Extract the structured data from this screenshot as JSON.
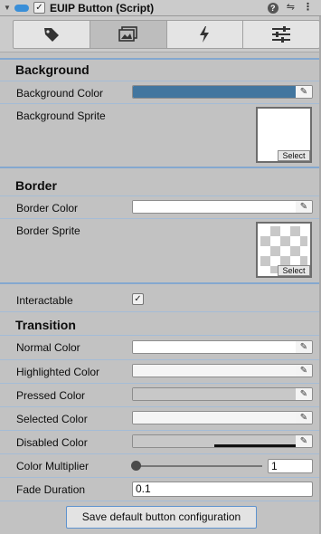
{
  "header": {
    "title": "EUIP Button (Script)",
    "enabled": true,
    "icons": [
      "help-icon",
      "preset-icon",
      "more-icon"
    ],
    "help_glyph": "?",
    "preset_glyph": "⇋",
    "more_glyph": "⋮"
  },
  "tabs": [
    {
      "name": "tag-icon",
      "active": false
    },
    {
      "name": "image-icon",
      "active": true
    },
    {
      "name": "lightning-icon",
      "active": false
    },
    {
      "name": "sliders-icon",
      "active": false
    }
  ],
  "background": {
    "section_title": "Background",
    "color_label": "Background Color",
    "color_value": "#42769f",
    "sprite_label": "Background Sprite",
    "sprite_select": "Select"
  },
  "border": {
    "section_title": "Border",
    "color_label": "Border Color",
    "color_value": "#ffffff",
    "sprite_label": "Border Sprite",
    "sprite_select": "Select"
  },
  "interactable": {
    "label": "Interactable",
    "checked": true,
    "check_glyph": "✓"
  },
  "transition": {
    "section_title": "Transition",
    "normal_label": "Normal Color",
    "normal_value": "#ffffff",
    "highlighted_label": "Highlighted Color",
    "highlighted_value": "#f5f5f5",
    "pressed_label": "Pressed Color",
    "pressed_value": "#c8c8c8",
    "selected_label": "Selected Color",
    "selected_value": "#f5f5f5",
    "disabled_label": "Disabled Color",
    "disabled_value": "#c8c8c8",
    "multiplier_label": "Color Multiplier",
    "multiplier_value": "1",
    "multiplier_slider_fraction": 0.0,
    "fade_label": "Fade Duration",
    "fade_value": "0.1"
  },
  "save_button_label": "Save default button configuration",
  "eyedropper_glyph": "✎",
  "fold_glyph": "▼"
}
